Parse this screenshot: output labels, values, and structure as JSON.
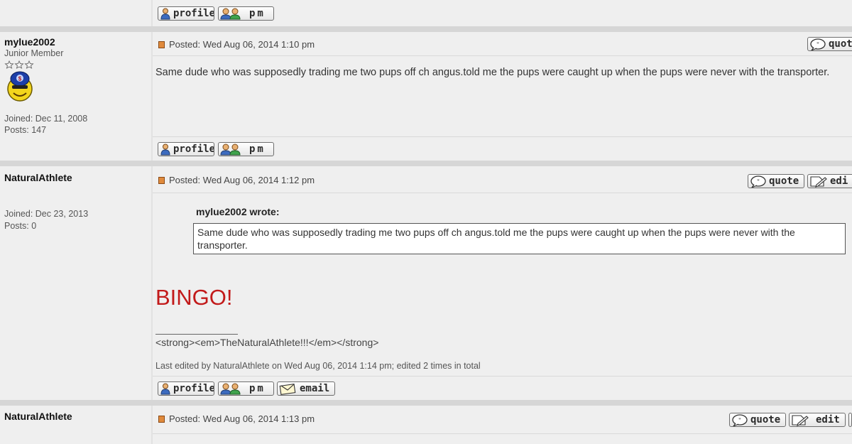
{
  "buttons": {
    "profile": "profile",
    "pm": "pm",
    "email": "email",
    "quote": "quote",
    "edit": "edit",
    "quote_partial": "quot",
    "edit_partial": "edi"
  },
  "posts": [
    {
      "username": "mylue2002",
      "rank": "Junior Member",
      "joined": "Joined: Dec 11, 2008",
      "posts": "Posts: 147",
      "posted": "Posted: Wed Aug 06, 2014 1:10 pm",
      "body": "Same dude who was supposedly trading me two pups off ch angus.told me the pups were caught up when the pups were never with the transporter."
    },
    {
      "username": "NaturalAthlete",
      "joined": "Joined: Dec 23, 2013",
      "posts": "Posts: 0",
      "posted": "Posted: Wed Aug 06, 2014 1:12 pm",
      "quote_author": "mylue2002 wrote:",
      "quote_text": "Same dude who was supposedly trading me two pups off ch angus.told me the pups were caught up when the pups were never with the transporter.",
      "highlight": "BINGO!",
      "signature": "<strong><em>TheNaturalAthlete!!!</em></strong>",
      "edited": "Last edited by NaturalAthlete on Wed Aug 06, 2014 1:14 pm; edited 2 times in total"
    },
    {
      "username": "NaturalAthlete",
      "posted": "Posted: Wed Aug 06, 2014 1:13 pm"
    }
  ],
  "colors": {
    "highlight": "#c21a1a",
    "post_bg": "#efefef",
    "separator": "#d6d6d6"
  }
}
